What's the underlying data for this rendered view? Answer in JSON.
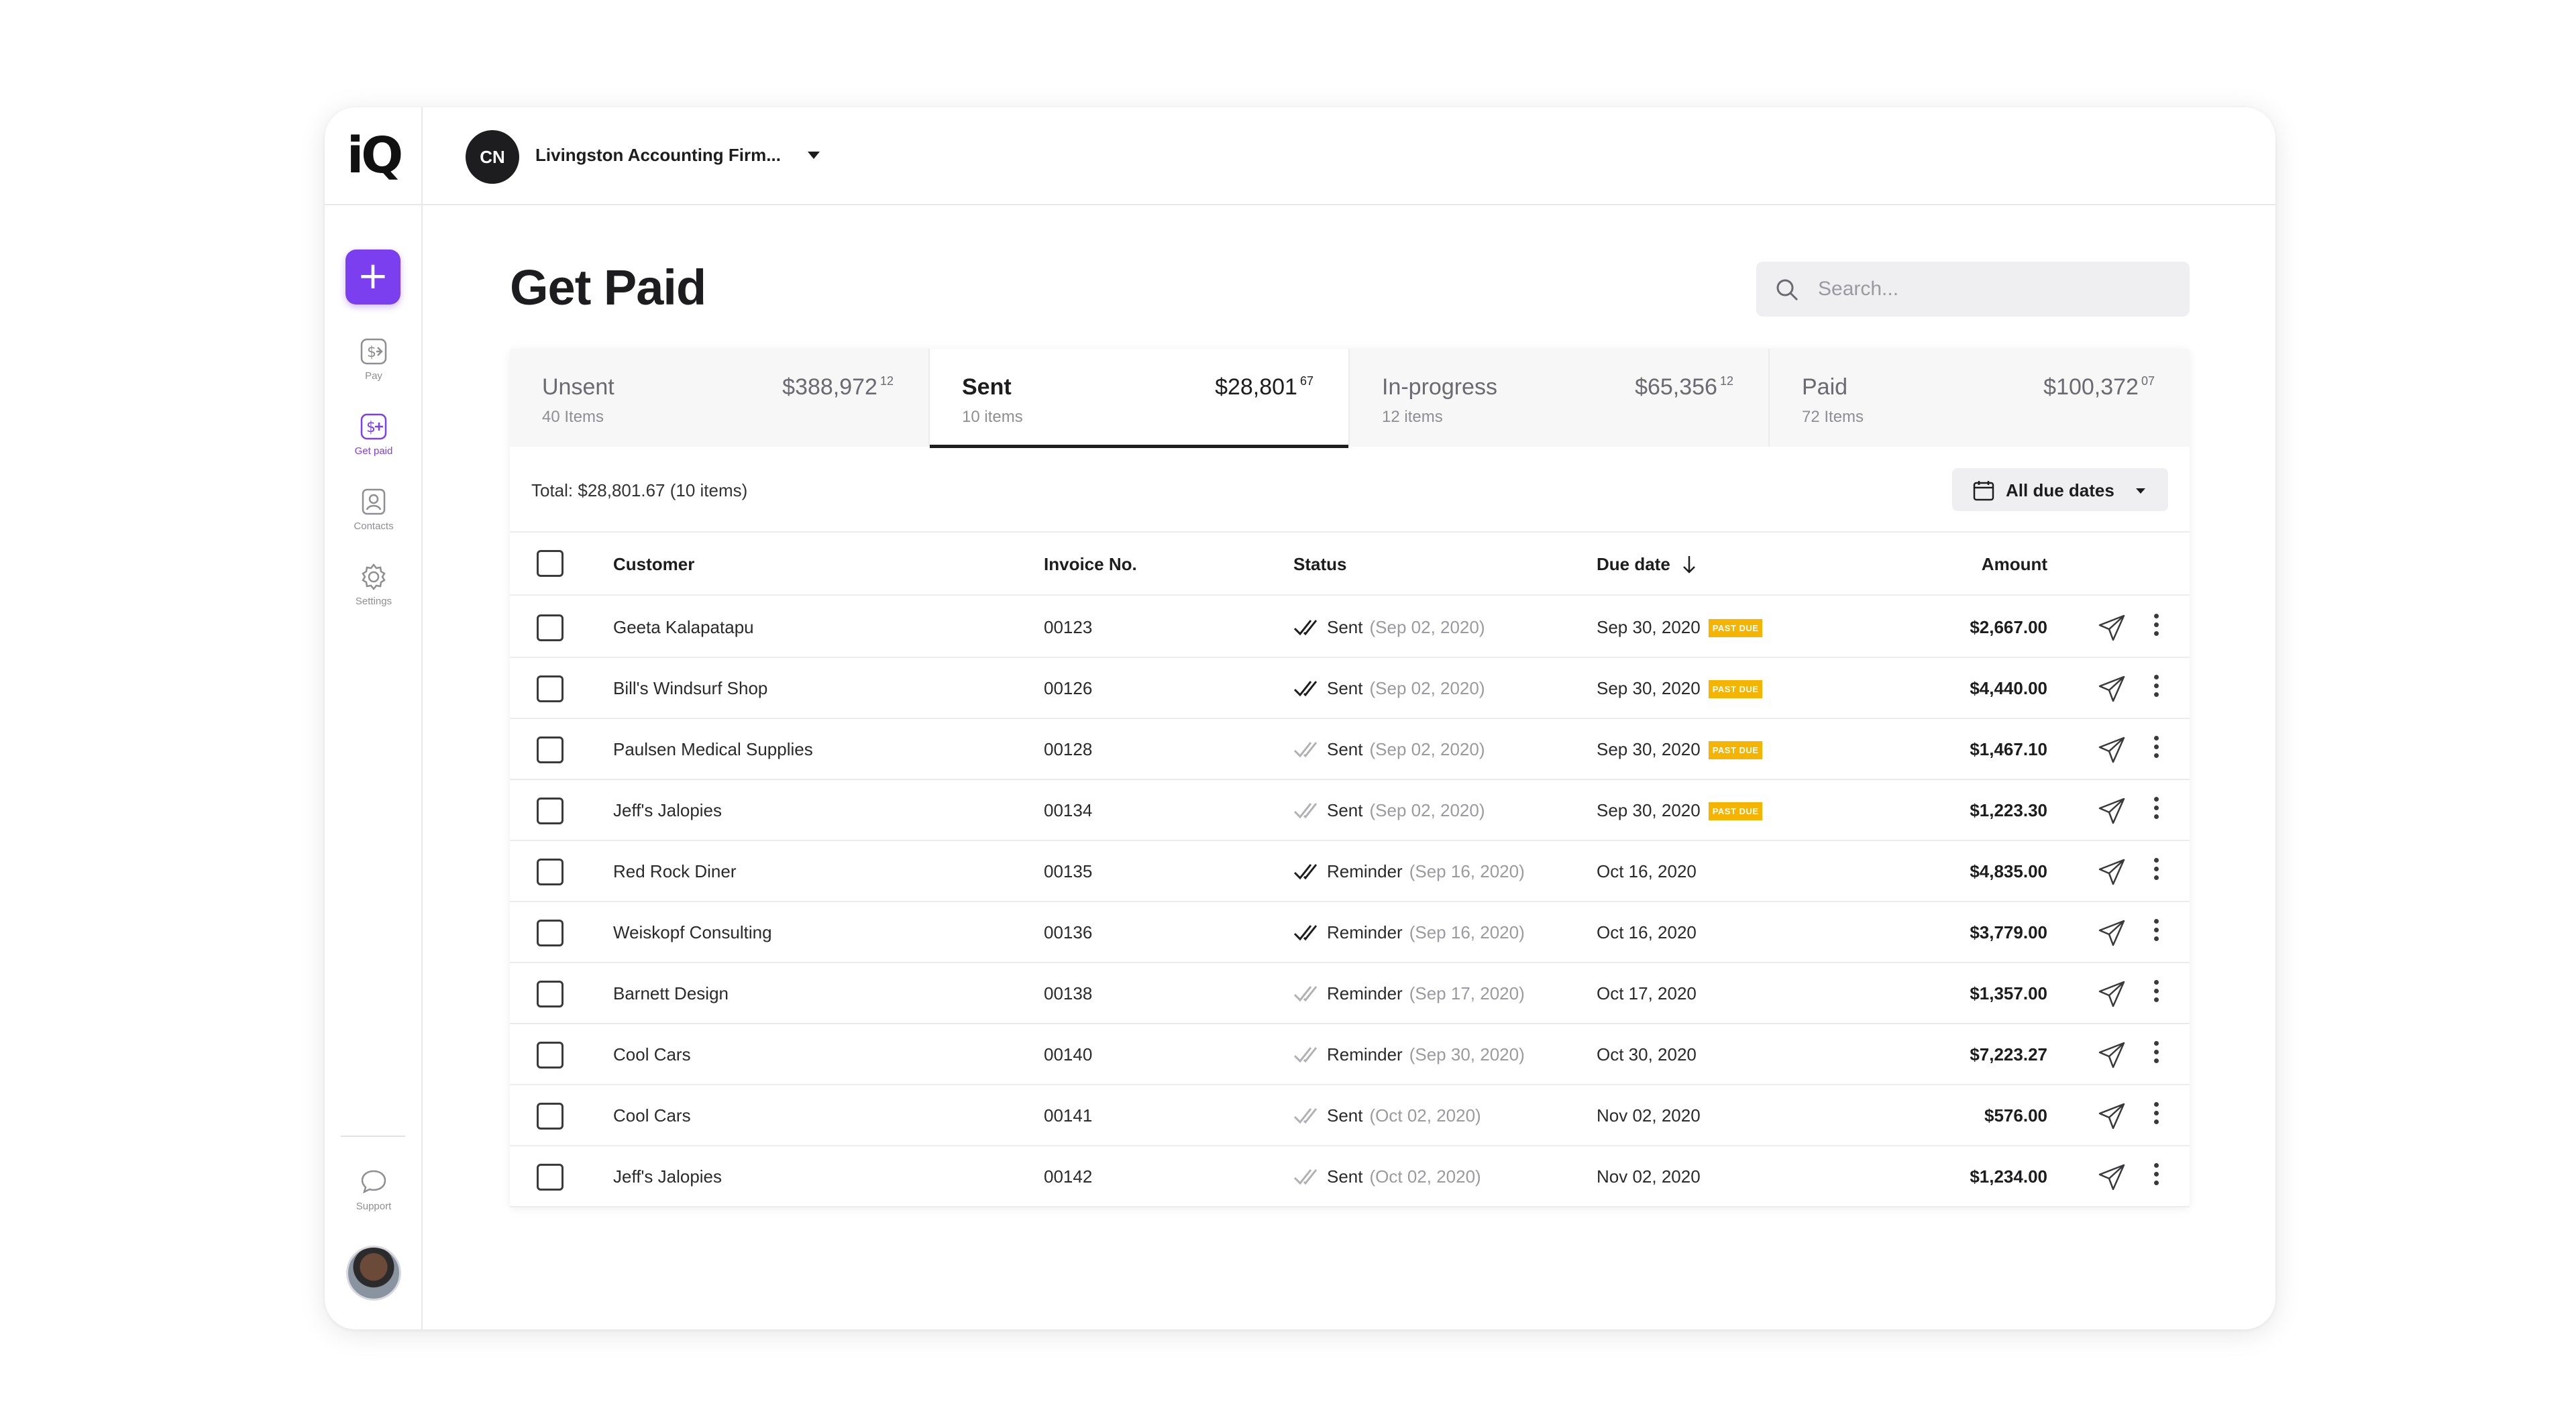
{
  "app": {
    "logo_text": "iQ"
  },
  "sidebar": {
    "add_label": "+",
    "items": [
      {
        "label": "Pay",
        "icon": "pay-icon"
      },
      {
        "label": "Get paid",
        "icon": "get-paid-icon",
        "active": true
      },
      {
        "label": "Contacts",
        "icon": "contacts-icon"
      },
      {
        "label": "Settings",
        "icon": "gear-icon"
      }
    ],
    "support_label": "Support"
  },
  "topbar": {
    "org_initials": "CN",
    "org_name": "Livingston Accounting Firm..."
  },
  "main": {
    "title": "Get Paid",
    "search_placeholder": "Search...",
    "tabs": [
      {
        "name": "Unsent",
        "count": "40 Items",
        "amount": "$388,972",
        "cents": "12"
      },
      {
        "name": "Sent",
        "count": "10 items",
        "amount": "$28,801",
        "cents": "67",
        "active": true
      },
      {
        "name": "In-progress",
        "count": "12 items",
        "amount": "$65,356",
        "cents": "12"
      },
      {
        "name": "Paid",
        "count": "72 Items",
        "amount": "$100,372",
        "cents": "07"
      }
    ],
    "total_text": "Total: $28,801.67 (10 items)",
    "filter_label": "All due dates",
    "columns": {
      "customer": "Customer",
      "invoice": "Invoice No.",
      "status": "Status",
      "due_date": "Due date",
      "amount": "Amount"
    },
    "past_due_label": "PAST DUE",
    "rows": [
      {
        "customer": "Geeta Kalapatapu",
        "invoice": "00123",
        "status": "Sent",
        "status_date": "(Sep 02, 2020)",
        "read": true,
        "due": "Sep 30, 2020",
        "past_due": true,
        "amount": "$2,667.00"
      },
      {
        "customer": "Bill's Windsurf Shop",
        "invoice": "00126",
        "status": "Sent",
        "status_date": "(Sep 02, 2020)",
        "read": true,
        "due": "Sep 30, 2020",
        "past_due": true,
        "amount": "$4,440.00"
      },
      {
        "customer": "Paulsen Medical Supplies",
        "invoice": "00128",
        "status": "Sent",
        "status_date": "(Sep 02, 2020)",
        "read": false,
        "due": "Sep 30, 2020",
        "past_due": true,
        "amount": "$1,467.10"
      },
      {
        "customer": "Jeff's Jalopies",
        "invoice": "00134",
        "status": "Sent",
        "status_date": "(Sep 02, 2020)",
        "read": false,
        "due": "Sep 30, 2020",
        "past_due": true,
        "amount": "$1,223.30"
      },
      {
        "customer": "Red Rock Diner",
        "invoice": "00135",
        "status": "Reminder",
        "status_date": "(Sep 16, 2020)",
        "read": true,
        "due": "Oct 16, 2020",
        "past_due": false,
        "amount": "$4,835.00"
      },
      {
        "customer": "Weiskopf Consulting",
        "invoice": "00136",
        "status": "Reminder",
        "status_date": "(Sep 16, 2020)",
        "read": true,
        "due": "Oct 16, 2020",
        "past_due": false,
        "amount": "$3,779.00"
      },
      {
        "customer": "Barnett Design",
        "invoice": "00138",
        "status": "Reminder",
        "status_date": "(Sep 17, 2020)",
        "read": false,
        "due": "Oct 17, 2020",
        "past_due": false,
        "amount": "$1,357.00"
      },
      {
        "customer": "Cool Cars",
        "invoice": "00140",
        "status": "Reminder",
        "status_date": "(Sep 30, 2020)",
        "read": false,
        "due": "Oct 30, 2020",
        "past_due": false,
        "amount": "$7,223.27"
      },
      {
        "customer": "Cool Cars",
        "invoice": "00141",
        "status": "Sent",
        "status_date": "(Oct 02, 2020)",
        "read": false,
        "due": "Nov 02, 2020",
        "past_due": false,
        "amount": "$576.00"
      },
      {
        "customer": "Jeff's Jalopies",
        "invoice": "00142",
        "status": "Sent",
        "status_date": "(Oct 02, 2020)",
        "read": false,
        "due": "Nov 02, 2020",
        "past_due": false,
        "amount": "$1,234.00"
      }
    ]
  },
  "colors": {
    "accent": "#7b3ff0",
    "past_due": "#f5b400"
  }
}
